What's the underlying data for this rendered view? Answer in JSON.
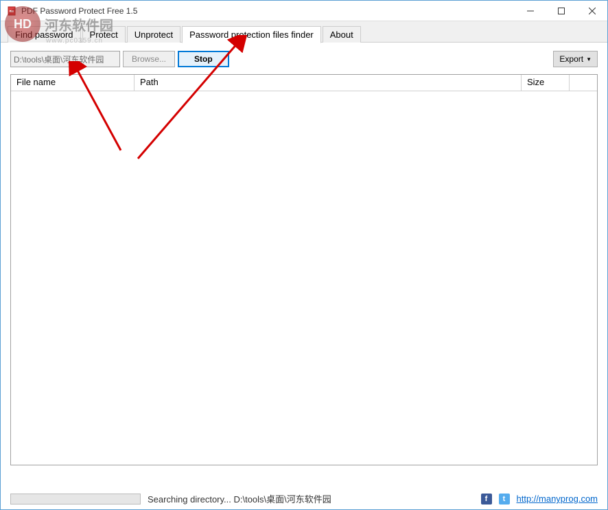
{
  "window": {
    "title": "PDF Password Protect Free 1.5"
  },
  "tabs": {
    "items": [
      {
        "label": "Find password",
        "active": false
      },
      {
        "label": "Protect",
        "active": false
      },
      {
        "label": "Unprotect",
        "active": false
      },
      {
        "label": "Password protection files finder",
        "active": true
      },
      {
        "label": "About",
        "active": false
      }
    ]
  },
  "toolbar": {
    "path_value": "D:\\tools\\桌面\\河东软件园",
    "browse_label": "Browse...",
    "stop_label": "Stop",
    "export_label": "Export"
  },
  "table": {
    "columns": {
      "filename": "File name",
      "path": "Path",
      "size": "Size"
    },
    "rows": []
  },
  "status": {
    "text": "Searching directory... D:\\tools\\桌面\\河东软件园",
    "link_text": "http://manyprog.com"
  },
  "watermark": {
    "logo_text": "HD",
    "name": "河东软件园",
    "url": "www.pc0359.cn"
  }
}
